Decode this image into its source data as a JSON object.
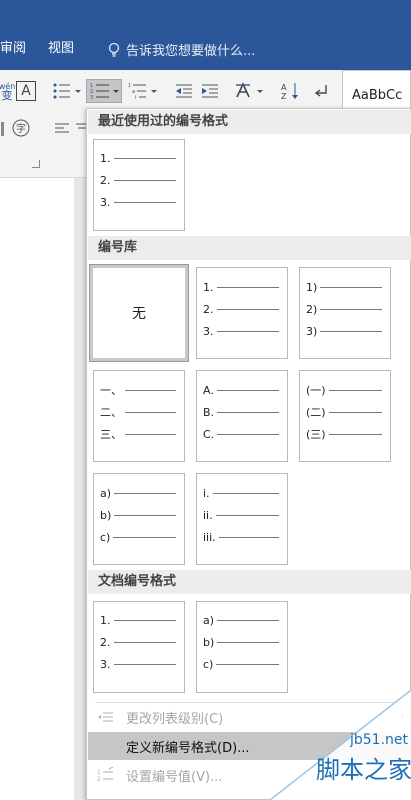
{
  "tabs": {
    "review": "审阅",
    "view": "视图"
  },
  "tellme": {
    "text": "告诉我您想要做什么..."
  },
  "ribbon": {
    "style_preview": "AaBbCc",
    "phonetic_top": "wén",
    "phonetic_bottom": "变",
    "char_border": "A"
  },
  "panel": {
    "recent_header": "最近使用过的编号格式",
    "library_header": "编号库",
    "document_header": "文档编号格式",
    "none_label": "无",
    "recent": [
      {
        "rows": [
          "1.",
          "2.",
          "3."
        ]
      }
    ],
    "library": [
      {
        "rows": [
          "1.",
          "2.",
          "3."
        ]
      },
      {
        "rows": [
          "1)",
          "2)",
          "3)"
        ]
      },
      {
        "rows": [
          "一、",
          "二、",
          "三、"
        ]
      },
      {
        "rows": [
          "A.",
          "B.",
          "C."
        ]
      },
      {
        "rows": [
          "(一)",
          "(二)",
          "(三)"
        ]
      },
      {
        "rows": [
          "a)",
          "b)",
          "c)"
        ]
      },
      {
        "rows": [
          "i.",
          "ii.",
          "iii."
        ]
      }
    ],
    "document": [
      {
        "rows": [
          "1.",
          "2.",
          "3."
        ]
      },
      {
        "rows": [
          "a)",
          "b)",
          "c)"
        ]
      }
    ]
  },
  "menu": {
    "change_level": "更改列表级别(C)",
    "define_new": "定义新编号格式(D)...",
    "set_value": "设置编号值(V)..."
  },
  "watermark": {
    "site": "jb51.net",
    "name": "脚本之家"
  },
  "colors": {
    "ribbon_blue": "#2b579a",
    "hover_gray": "#c6c6c6",
    "watermark_blue": "#1b70b8"
  }
}
